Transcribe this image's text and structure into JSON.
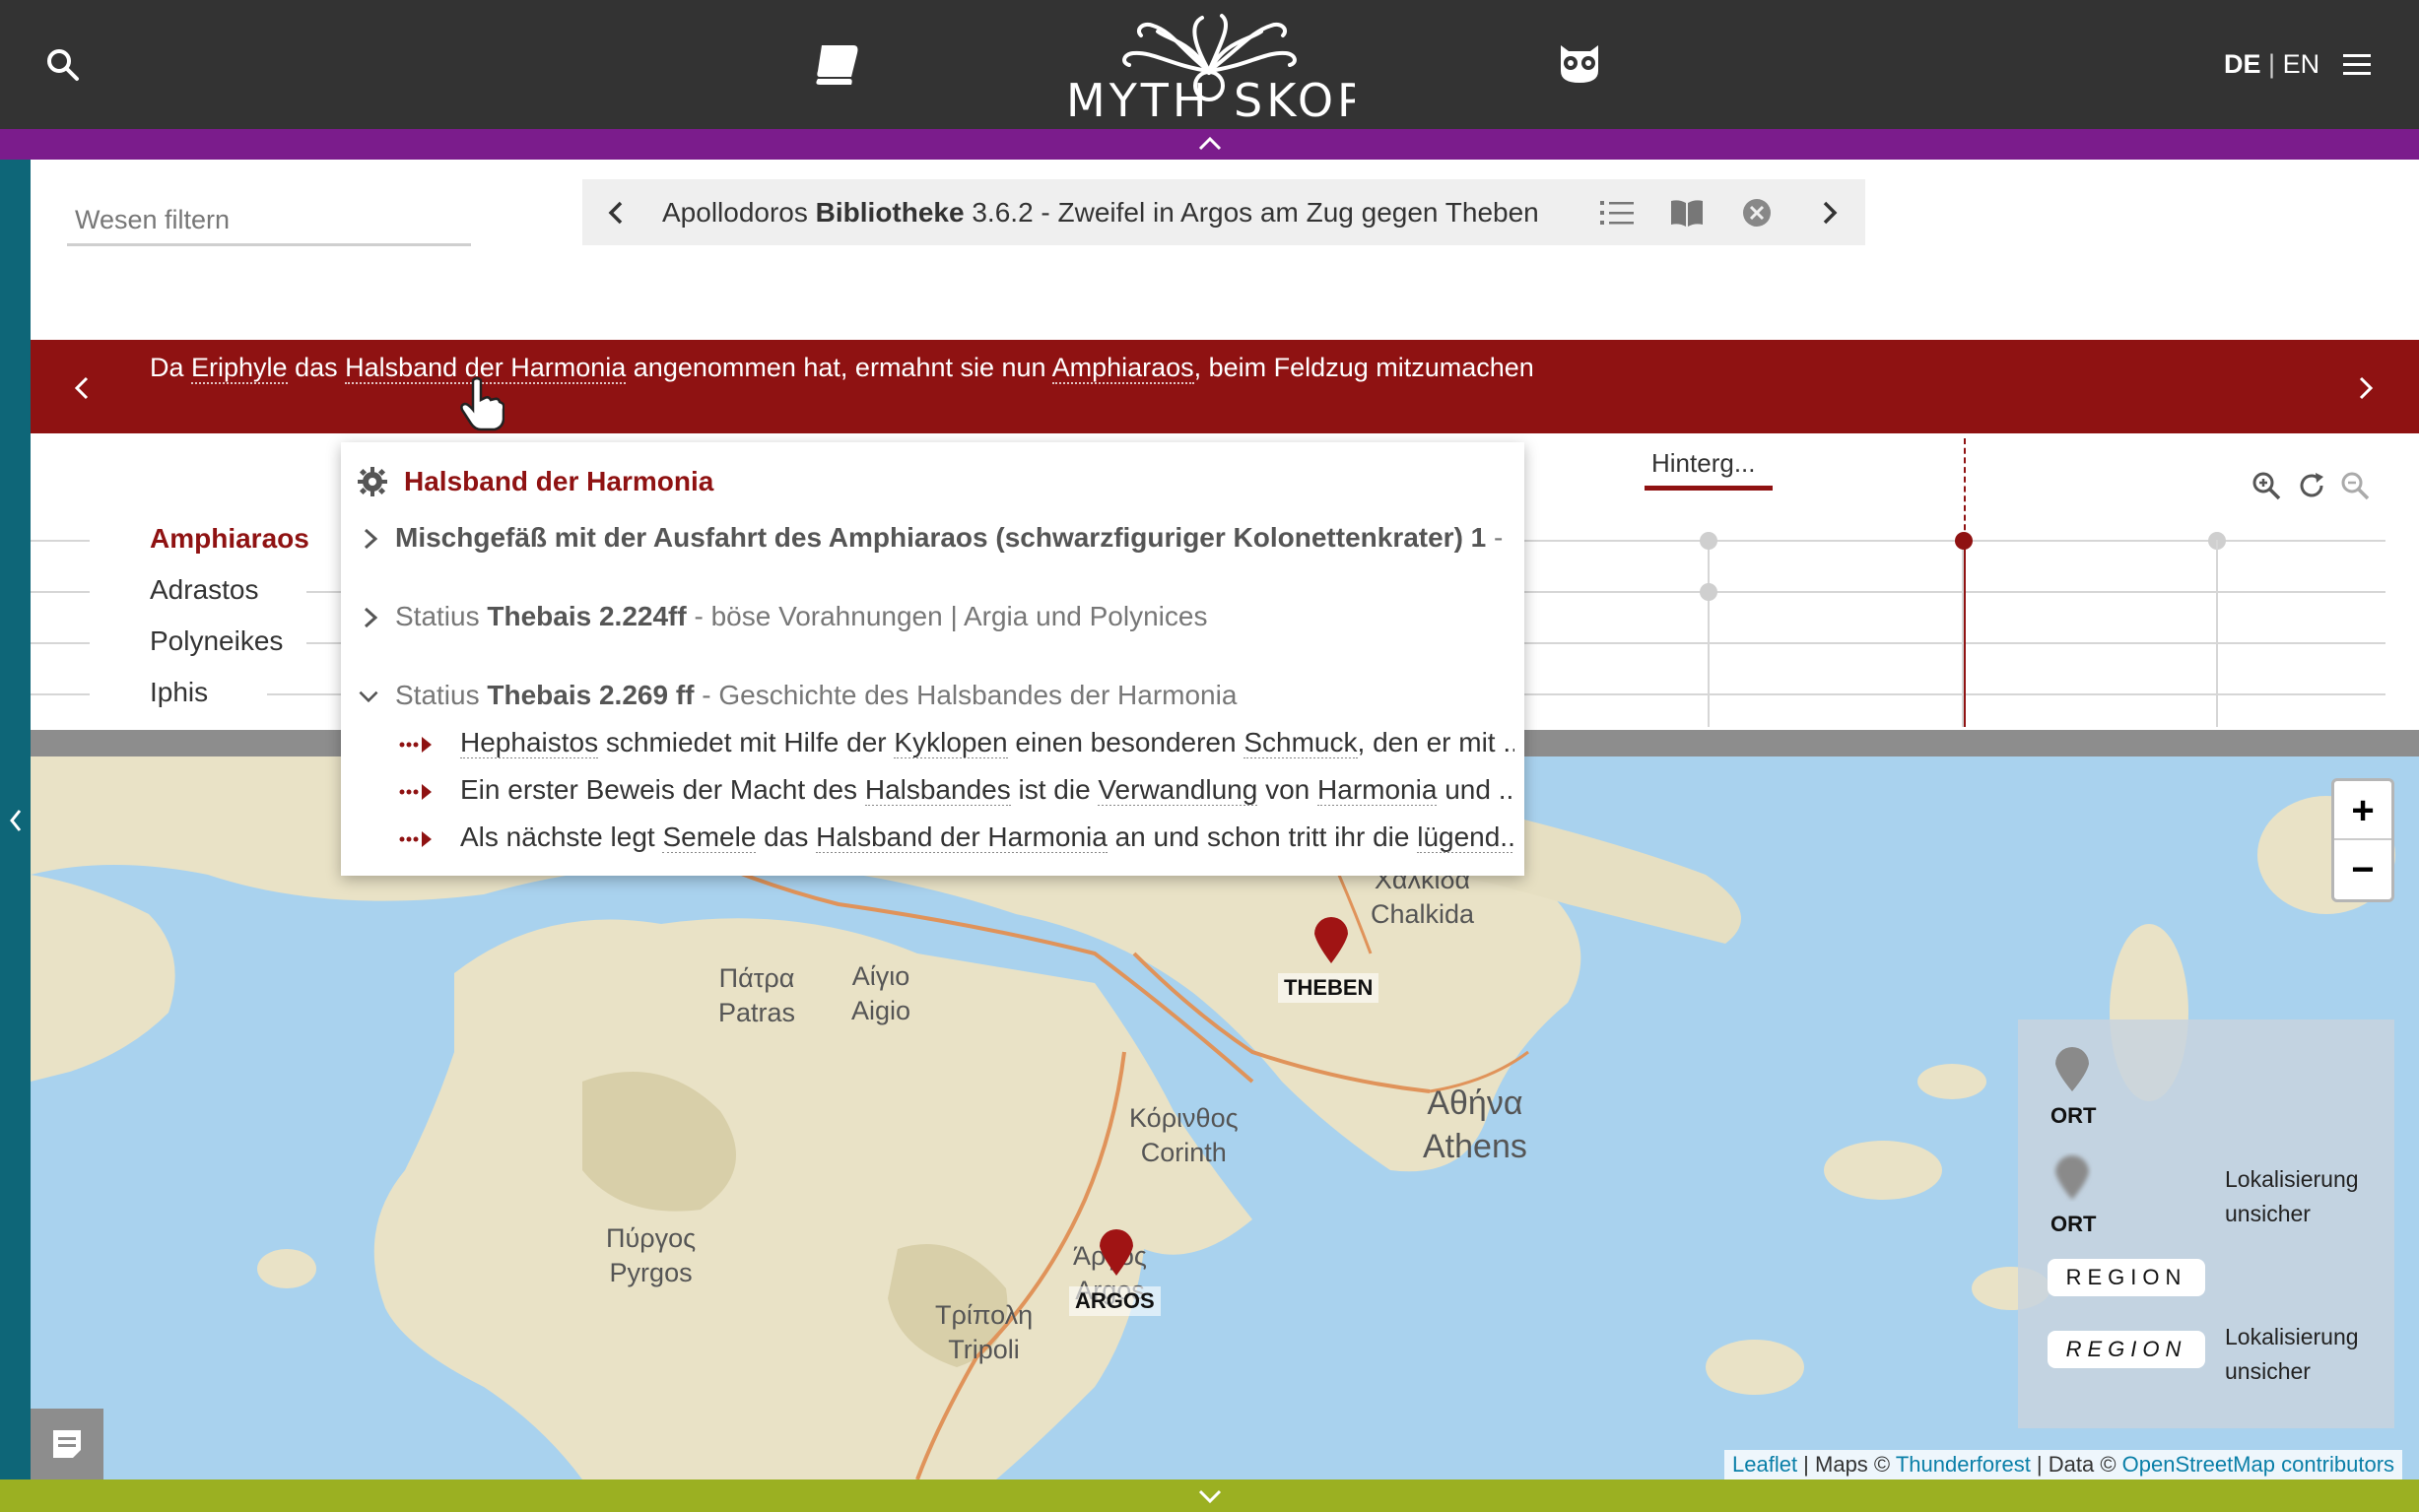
{
  "header": {
    "lang_de": "DE",
    "lang_sep": "|",
    "lang_en": "EN",
    "logo_text": "MYTHOSKOP"
  },
  "filter": {
    "placeholder": "Wesen filtern"
  },
  "source_nav": {
    "author": "Apollodoros",
    "work": "Bibliotheke",
    "rest": "3.6.2 - Zweifel in Argos am Zug gegen Theben"
  },
  "event": {
    "parts": [
      "Da ",
      "Eriphyle",
      " das ",
      "Halsband der Harmonia",
      " angenommen hat, ermahnt sie nun ",
      "Amphiaraos",
      ", beim Feldzug mitzumachen"
    ]
  },
  "timeline": {
    "persons": [
      "Amphiaraos",
      "Adrastos",
      "Polyneikes",
      "Iphis"
    ],
    "tab_label": "Hinterg..."
  },
  "popup": {
    "title": "Halsband der Harmonia",
    "sources": [
      {
        "pre": "",
        "bold": "Mischgefäß mit der Ausfahrt des Amphiaraos (schwarzfiguriger Kolonettenkrater) 1",
        "post": " - Au..."
      },
      {
        "pre": "Statius ",
        "bold": "Thebais 2.224ff",
        "post": " - böse Vorahnungen | Argia und Polynices"
      },
      {
        "pre": "Statius ",
        "bold": "Thebais 2.269 ff",
        "post": " - Geschichte des Halsbandes der Harmonia"
      }
    ],
    "events": [
      [
        "Hephaistos",
        " schmiedet mit Hilfe der ",
        "Kyklopen",
        " einen besonderen ",
        "Schmuck",
        ", den er mit ..."
      ],
      [
        "Ein erster Beweis der Macht des ",
        "Halsbandes",
        " ist die ",
        "Verwandlung",
        " von ",
        "Harmonia",
        " und ..."
      ],
      [
        "Als nächste legt ",
        "Semele",
        " das ",
        "Halsband der Harmonia",
        " an und schon tritt ihr die ",
        "lügend..."
      ]
    ]
  },
  "map": {
    "labels": {
      "patras_gr": "Πάτρα",
      "patras_en": "Patras",
      "aigio_gr": "Αίγιο",
      "aigio_en": "Aigio",
      "chalkida_gr": "Χαλκίδα",
      "chalkida_en": "Chalkida",
      "korinthos_gr": "Κόρινθος",
      "korinthos_en": "Corinth",
      "athina_gr": "Αθήνα",
      "athina_en": "Athens",
      "pyrgos_gr": "Πύργος",
      "pyrgos_en": "Pyrgos",
      "tripoli_gr": "Τρίπολη",
      "tripoli_en": "Tripoli",
      "argos_gr": "Άργος",
      "argos_en": "Argos"
    },
    "markers": [
      "THEBEN",
      "ARGOS"
    ],
    "zoom_in": "+",
    "zoom_out": "−",
    "legend": {
      "ort": "ORT",
      "ort_unsure": "ORT",
      "region": "REGION",
      "region_unsure": "REGION",
      "unsure_1": "Lokalisierung unsicher",
      "unsure_2": "Lokalisierung unsicher"
    },
    "attribution": {
      "leaflet": "Leaflet",
      "maps": " | Maps © ",
      "thunderforest": "Thunderforest",
      "data": " | Data © ",
      "osm": "OpenStreetMap contributors"
    }
  },
  "colors": {
    "header": "#333333",
    "purple": "#7b1c8c",
    "banner_red": "#8f1212",
    "side_teal": "#0e6678",
    "bottom_green": "#9bb022",
    "water": "#a9d2ee"
  }
}
